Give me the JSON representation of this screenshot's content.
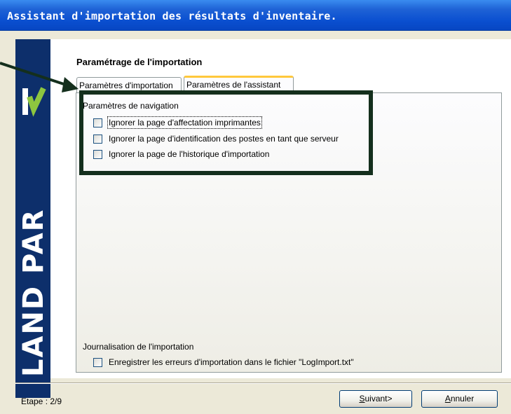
{
  "window": {
    "title": "Assistant d'importation des résultats d'inventaire."
  },
  "brand": {
    "logo_text": "LAND PARK",
    "accent_color": "#8dc63f",
    "background_color": "#0d2f6b"
  },
  "section": {
    "title": "Paramétrage de l'importation"
  },
  "tabs": [
    {
      "label": "Paramètres d'importation",
      "active": false
    },
    {
      "label": "Paramètres de l'assistant",
      "active": true
    }
  ],
  "navigation_group": {
    "label": "Paramètres de navigation",
    "options": [
      {
        "label": "Ignorer la page d'affectation imprimantes",
        "checked": false
      },
      {
        "label": "Ignorer la page d'identification des postes en tant que serveur",
        "checked": false
      },
      {
        "label": "Ignorer la page de l'historique d'importation",
        "checked": false
      }
    ]
  },
  "logging_group": {
    "label": "Journalisation de l'importation",
    "option": {
      "label": "Enregistrer les erreurs d'importation dans le fichier \"LogImport.txt\"",
      "checked": false
    }
  },
  "footer": {
    "step_label": "Etape :",
    "step_value": "2/9",
    "next_button": {
      "accel": "S",
      "rest": "uivant>"
    },
    "cancel_button": {
      "accel": "A",
      "rest": "nnuler"
    }
  },
  "annotation": {
    "highlight_color": "#142f1d"
  }
}
